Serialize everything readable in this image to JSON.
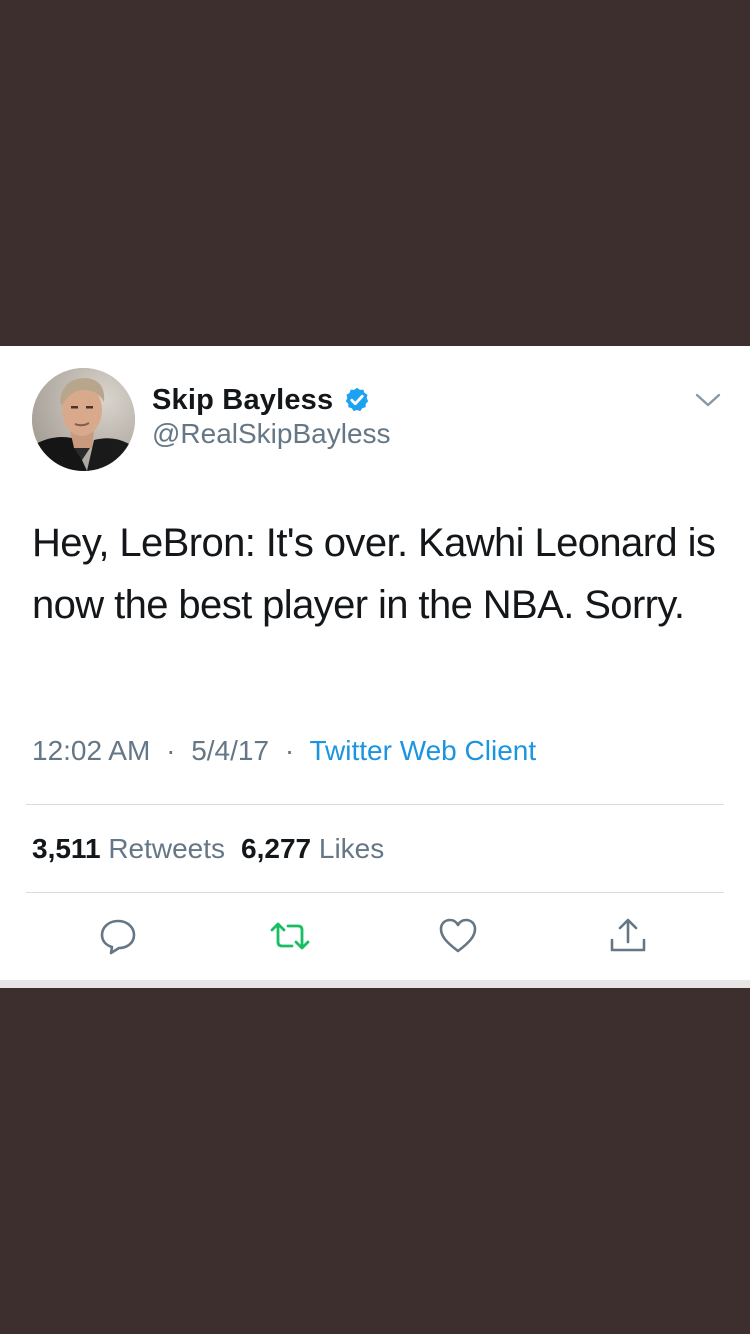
{
  "tweet": {
    "author": {
      "display_name": "Skip Bayless",
      "handle": "@RealSkipBayless",
      "verified": true
    },
    "text": "Hey, LeBron: It's over. Kawhi Leonard is now the best player in the NBA. Sorry.",
    "meta": {
      "time": "12:02 AM",
      "separator": "·",
      "date": "5/4/17",
      "source": "Twitter Web Client"
    },
    "stats": {
      "retweets_count": "3,511",
      "retweets_label": "Retweets",
      "likes_count": "6,277",
      "likes_label": "Likes"
    },
    "actions": {
      "reply_icon": "reply-icon",
      "retweet_icon": "retweet-icon",
      "like_icon": "heart-icon",
      "share_icon": "share-icon"
    }
  },
  "colors": {
    "background": "#3d2f2e",
    "card": "#ffffff",
    "text_primary": "#14171a",
    "text_secondary": "#657786",
    "link": "#1b95e0",
    "verified": "#1da1f2",
    "retweet_green": "#17bf63",
    "divider": "#d8dde1"
  }
}
